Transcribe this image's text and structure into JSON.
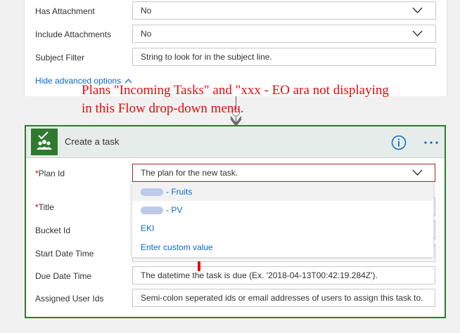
{
  "advanced_fields": [
    {
      "label": "Has Attachment",
      "value": "No"
    },
    {
      "label": "Include Attachments",
      "value": "No"
    },
    {
      "label": "Subject Filter",
      "placeholder": "String to look for in the subject line."
    }
  ],
  "advanced_toggle": "Hide advanced options",
  "annotation": {
    "line1": "Plans \"Incoming Tasks\" and \"xxx - EO ara not displaying",
    "line2": "in this Flow drop-down menu."
  },
  "task_card": {
    "title": "Create a task",
    "fields": {
      "plan_id": {
        "label": "Plan Id",
        "placeholder": "The plan for the new task."
      },
      "title": {
        "label": "Title"
      },
      "bucket_id": {
        "label": "Bucket Id"
      },
      "start_date": {
        "label": "Start Date Time"
      },
      "due_date": {
        "label": "Due Date Time",
        "placeholder": "The datetime the task is due (Ex. '2018-04-13T00:42:19.284Z')."
      },
      "assigned": {
        "label": "Assigned User Ids",
        "placeholder": "Semi-colon seperated ids or email addresses of users to assign this task to."
      }
    },
    "required_marker": "*"
  },
  "plan_dropdown": {
    "options": [
      {
        "label": "- Fruits"
      },
      {
        "label": "- PV"
      },
      {
        "label": "EKI"
      },
      {
        "label": "Enter custom value"
      }
    ]
  },
  "colors": {
    "card_border": "#2f7a2f",
    "link": "#0b6ac9",
    "annotation": "#e30c0c"
  },
  "icons": {
    "planner": "planner-check-people-icon",
    "info": "info-circle-icon",
    "more": "ellipsis-icon",
    "chevron": "chevron-down-icon",
    "toggle": "chevron-up-icon"
  }
}
